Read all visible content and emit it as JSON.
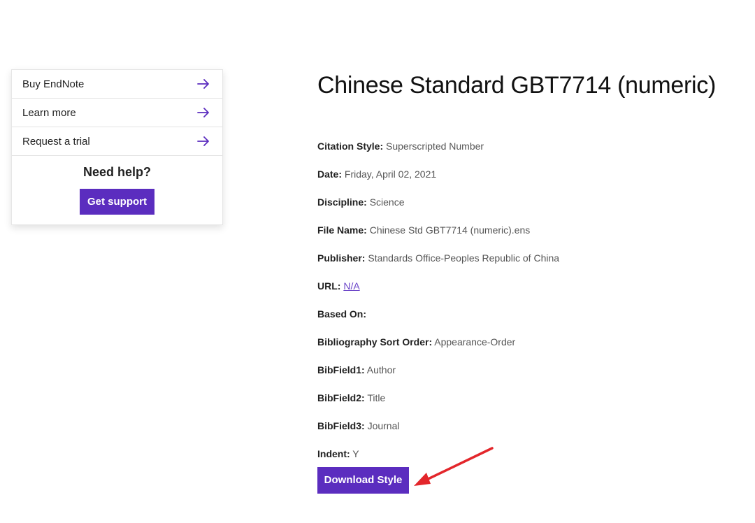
{
  "sidebar": {
    "links": [
      {
        "label": "Buy EndNote",
        "icon": "arrow-right-icon"
      },
      {
        "label": "Learn more",
        "icon": "arrow-right-icon"
      },
      {
        "label": "Request a trial",
        "icon": "arrow-right-icon"
      }
    ],
    "help_title": "Need help?",
    "support_button": "Get support"
  },
  "main": {
    "title": "Chinese Standard GBT7714 (numeric)",
    "fields": [
      {
        "label": "Citation Style:",
        "value": "Superscripted Number"
      },
      {
        "label": "Date:",
        "value": "Friday, April 02, 2021"
      },
      {
        "label": "Discipline:",
        "value": "Science"
      },
      {
        "label": "File Name:",
        "value": "Chinese Std GBT7714 (numeric).ens"
      },
      {
        "label": "Publisher:",
        "value": "Standards Office-Peoples Republic of China"
      },
      {
        "label": "URL:",
        "value": "N/A"
      },
      {
        "label": "Based On:",
        "value": ""
      },
      {
        "label": "Bibliography Sort Order:",
        "value": "Appearance-Order"
      },
      {
        "label": "BibField1:",
        "value": "Author"
      },
      {
        "label": "BibField2:",
        "value": "Title"
      },
      {
        "label": "BibField3:",
        "value": "Journal"
      },
      {
        "label": "Indent:",
        "value": "Y"
      }
    ],
    "download_button": "Download Style"
  },
  "colors": {
    "accent": "#5b2dbf",
    "link": "#6a44c8",
    "annotation": "#e3262b"
  }
}
